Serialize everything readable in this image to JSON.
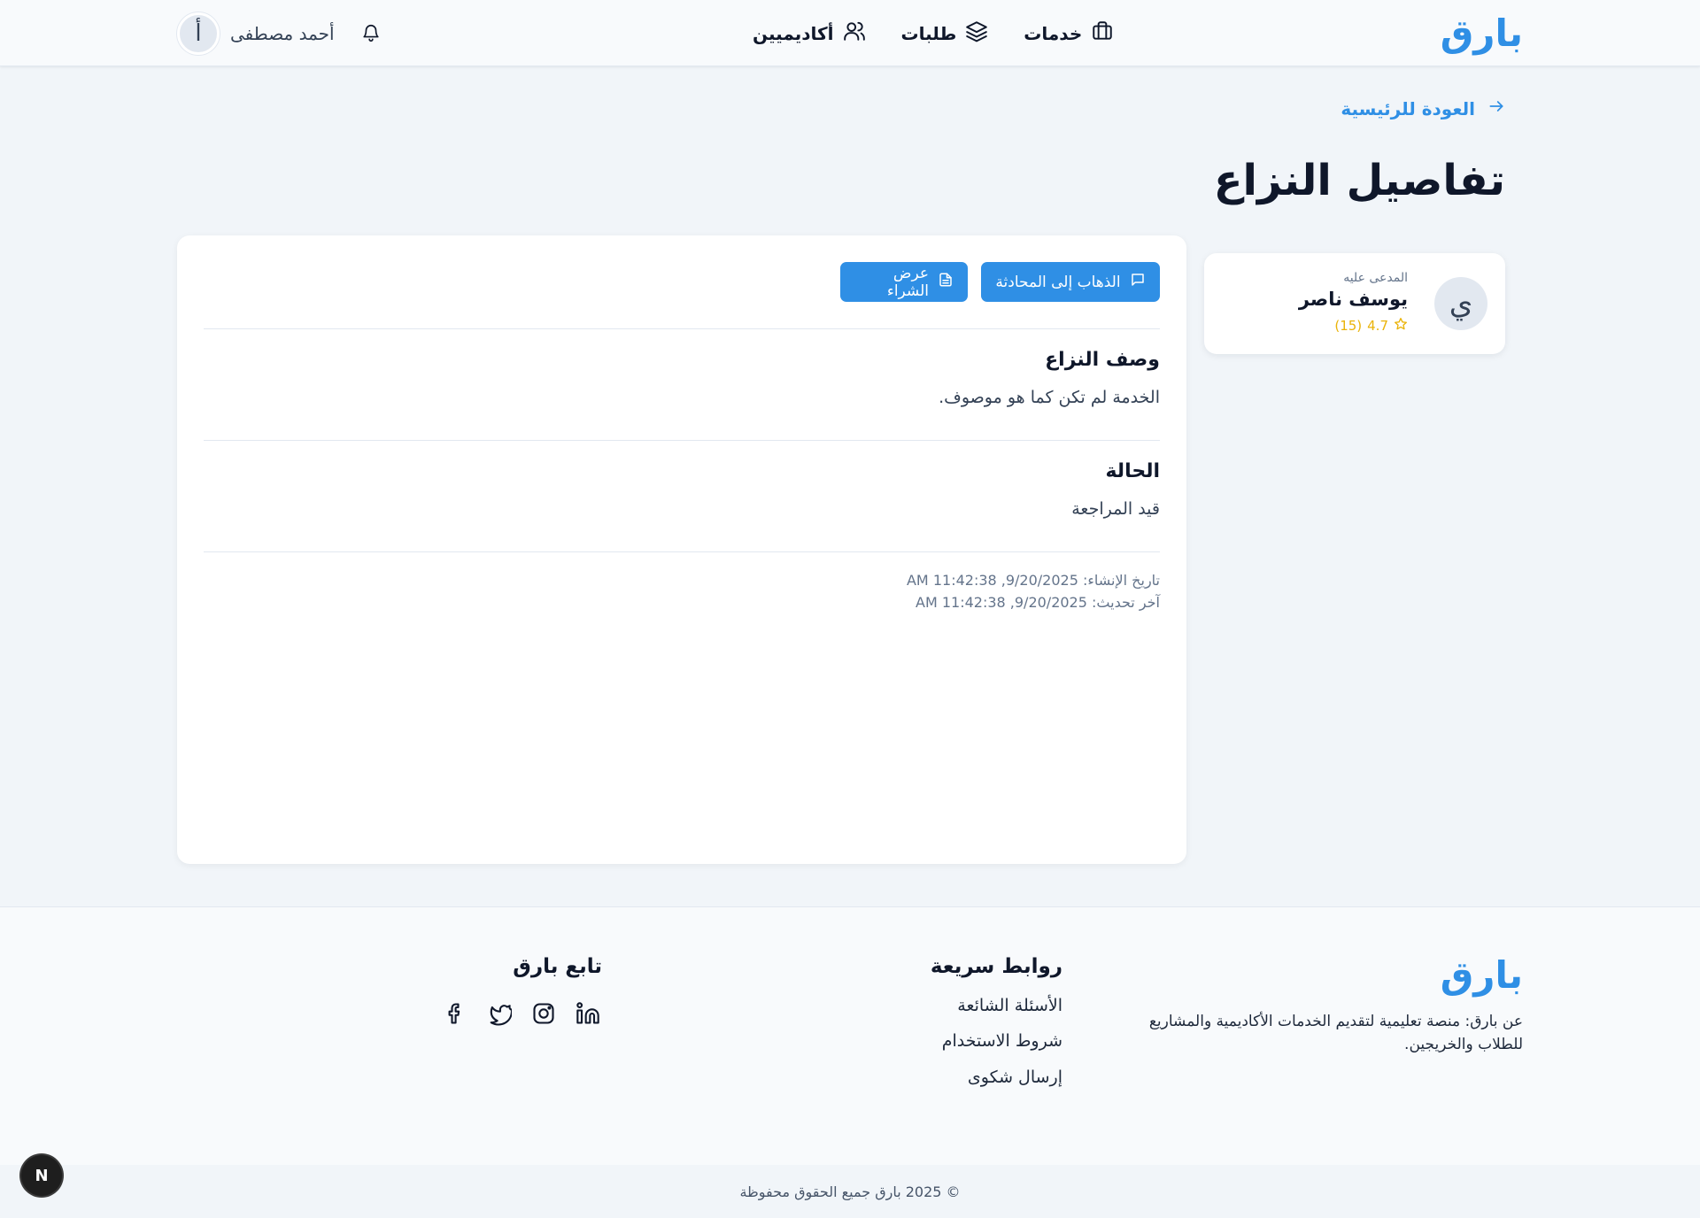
{
  "header": {
    "logo": "بارق",
    "nav": [
      {
        "label": "خدمات",
        "icon": "briefcase-icon"
      },
      {
        "label": "طلبات",
        "icon": "layers-icon"
      },
      {
        "label": "أكاديميين",
        "icon": "users-icon"
      }
    ],
    "user": {
      "initial": "أ",
      "name": "أحمد مصطفى"
    },
    "notification_icon": "bell-icon"
  },
  "main": {
    "back_link": "العودة للرئيسية",
    "title": "تفاصيل النزاع",
    "defendant": {
      "role": "المدعى عليه",
      "initial": "ي",
      "name": "يوسف ناصر",
      "rating": "4.7",
      "reviews": "(15)"
    },
    "actions": {
      "chat": "الذهاب إلى المحادثة",
      "order": "عرض الشراء"
    },
    "description": {
      "title": "وصف النزاع",
      "text": "الخدمة لم تكن كما هو موصوف."
    },
    "status": {
      "title": "الحالة",
      "text": "قيد المراجعة"
    },
    "created": "تاريخ الإنشاء: 9/20/2025, 11:42:38 AM",
    "updated": "آخر تحديث: 9/20/2025, 11:42:38 AM"
  },
  "footer": {
    "logo": "بارق",
    "about": "عن بارق: منصة تعليمية لتقديم الخدمات الأكاديمية والمشاريع للطلاب والخريجين.",
    "quick_links_title": "روابط سريعة",
    "links": [
      "الأسئلة الشائعة",
      "شروط الاستخدام",
      "إرسال شكوى"
    ],
    "follow_title": "تابع بارق",
    "socials": [
      "facebook-icon",
      "twitter-icon",
      "instagram-icon",
      "linkedin-icon"
    ],
    "copyright": "© 2025 بارق جميع الحقوق محفوظة"
  },
  "dev_badge": "N",
  "colors": {
    "accent": "#2f8fe5",
    "rating": "#eab308",
    "background": "#f1f5f9"
  }
}
